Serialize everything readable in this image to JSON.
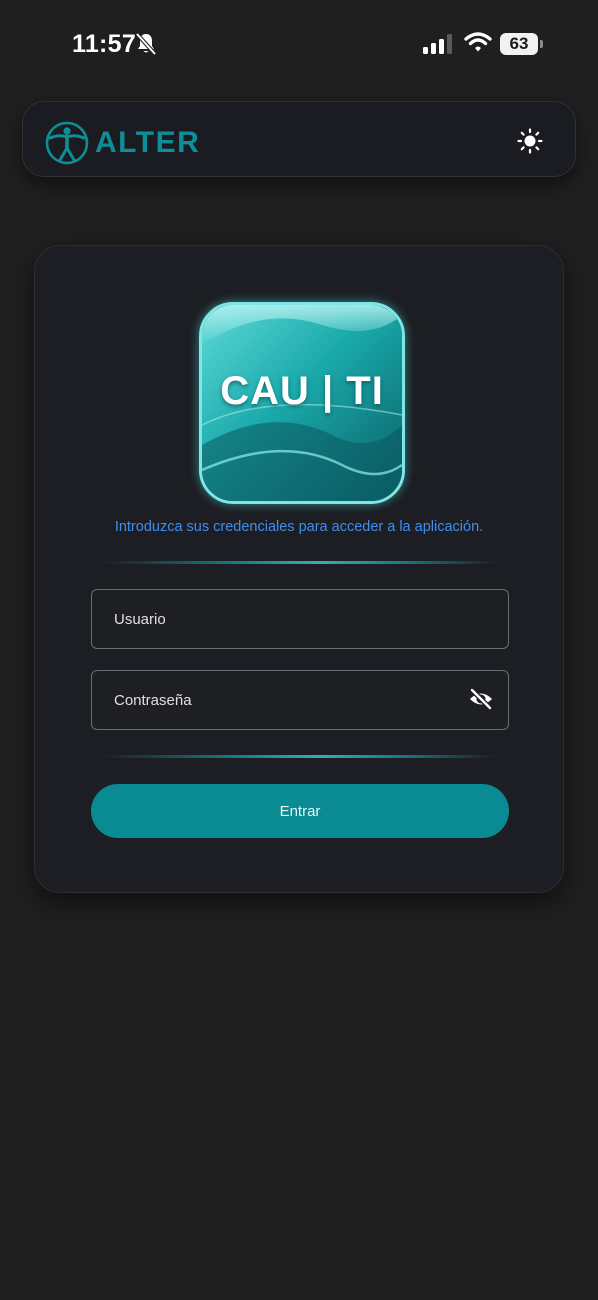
{
  "status_bar": {
    "time": "11:57",
    "battery_level": "63",
    "icons": [
      "bell-slash-icon",
      "cellular-signal-icon",
      "wifi-icon",
      "battery-icon"
    ]
  },
  "header": {
    "brand_name": "ALTER",
    "brand_icon": "vitruvian-figure-icon",
    "theme_toggle_icon": "sun-icon"
  },
  "login": {
    "logo_text": "CAU | TI",
    "subtitle": "Introduzca sus credenciales para acceder a la aplicación.",
    "username_placeholder": "Usuario",
    "password_placeholder": "Contraseña",
    "password_toggle_icon": "eye-off-icon",
    "submit_label": "Entrar"
  },
  "colors": {
    "background": "#1f1f1f",
    "accent": "#0a8a92",
    "brand": "#0e8e97",
    "subtitle": "#3f8ef0"
  }
}
